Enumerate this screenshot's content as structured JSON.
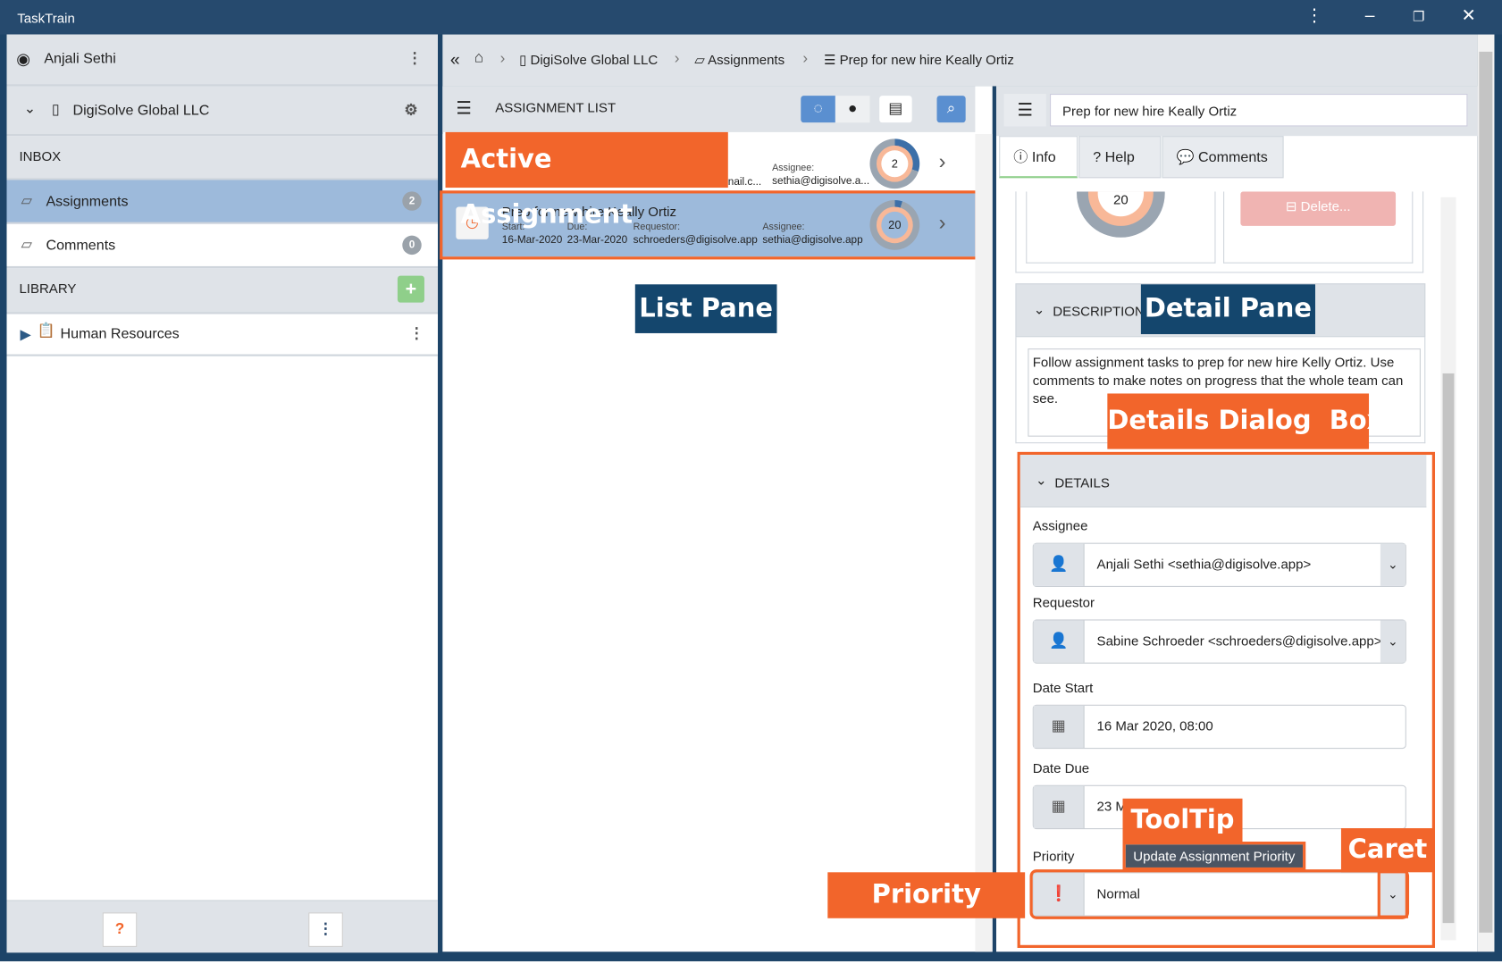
{
  "window": {
    "title": "TaskTrain"
  },
  "sidebar": {
    "user": "Anjali Sethi",
    "org": "DigiSolve Global LLC",
    "inbox_label": "INBOX",
    "items": [
      {
        "label": "Assignments",
        "count": "2"
      },
      {
        "label": "Comments",
        "count": "0"
      }
    ],
    "library_label": "LIBRARY",
    "library_items": [
      {
        "label": "Human Resources"
      }
    ]
  },
  "breadcrumb": {
    "items": [
      "DigiSolve Global LLC",
      "Assignments",
      "Prep for new hire Keally Ortiz"
    ]
  },
  "list": {
    "title": "ASSIGNMENT LIST",
    "rows": [
      {
        "requestor_trunc": "nail.c...",
        "assignee_label": "Assignee:",
        "assignee": "sethia@digisolve.a...",
        "progress": "2",
        "progress_fraction": 0.3
      },
      {
        "title": "Prep for new hire Keally Ortiz",
        "start_label": "Start:",
        "start": "16-Mar-2020",
        "due_label": "Due:",
        "due": "23-Mar-2020",
        "requestor_label": "Requestor:",
        "requestor": "schroeders@digisolve.app",
        "assignee_label": "Assignee:",
        "assignee": "sethia@digisolve.app",
        "progress": "20",
        "progress_fraction": 0.05
      }
    ]
  },
  "detail": {
    "title": "Prep for new hire Keally Ortiz",
    "tabs": [
      "Info",
      "Help",
      "Comments"
    ],
    "progress": "20",
    "delete_label": "Delete...",
    "description_header": "DESCRIPTION",
    "description": "Follow assignment tasks to prep for new hire Kelly Ortiz. Use comments to make notes on progress that the whole team can see.",
    "details_header": "DETAILS",
    "assignee_label": "Assignee",
    "assignee": "Anjali Sethi <sethia@digisolve.app>",
    "requestor_label": "Requestor",
    "requestor": "Sabine Schroeder <schroeders@digisolve.app>",
    "date_start_label": "Date Start",
    "date_start": "16 Mar 2020, 08:00",
    "date_due_label": "Date Due",
    "date_due": "23 M",
    "priority_label": "Priority",
    "priority": "Normal",
    "tooltip": "Update Assignment Priority"
  },
  "annotations": {
    "active_assignment": "Active Assignment",
    "list_pane": "List Pane",
    "detail_pane": "Detail Pane",
    "details_dialog": "Details Dialog  Box",
    "tooltip": "ToolTip",
    "caret": "Caret",
    "priority_menu": "Priority Menu"
  },
  "colors": {
    "accent": "#f2652b",
    "selected": "#9dbadb",
    "titlebar": "#264a6e"
  }
}
